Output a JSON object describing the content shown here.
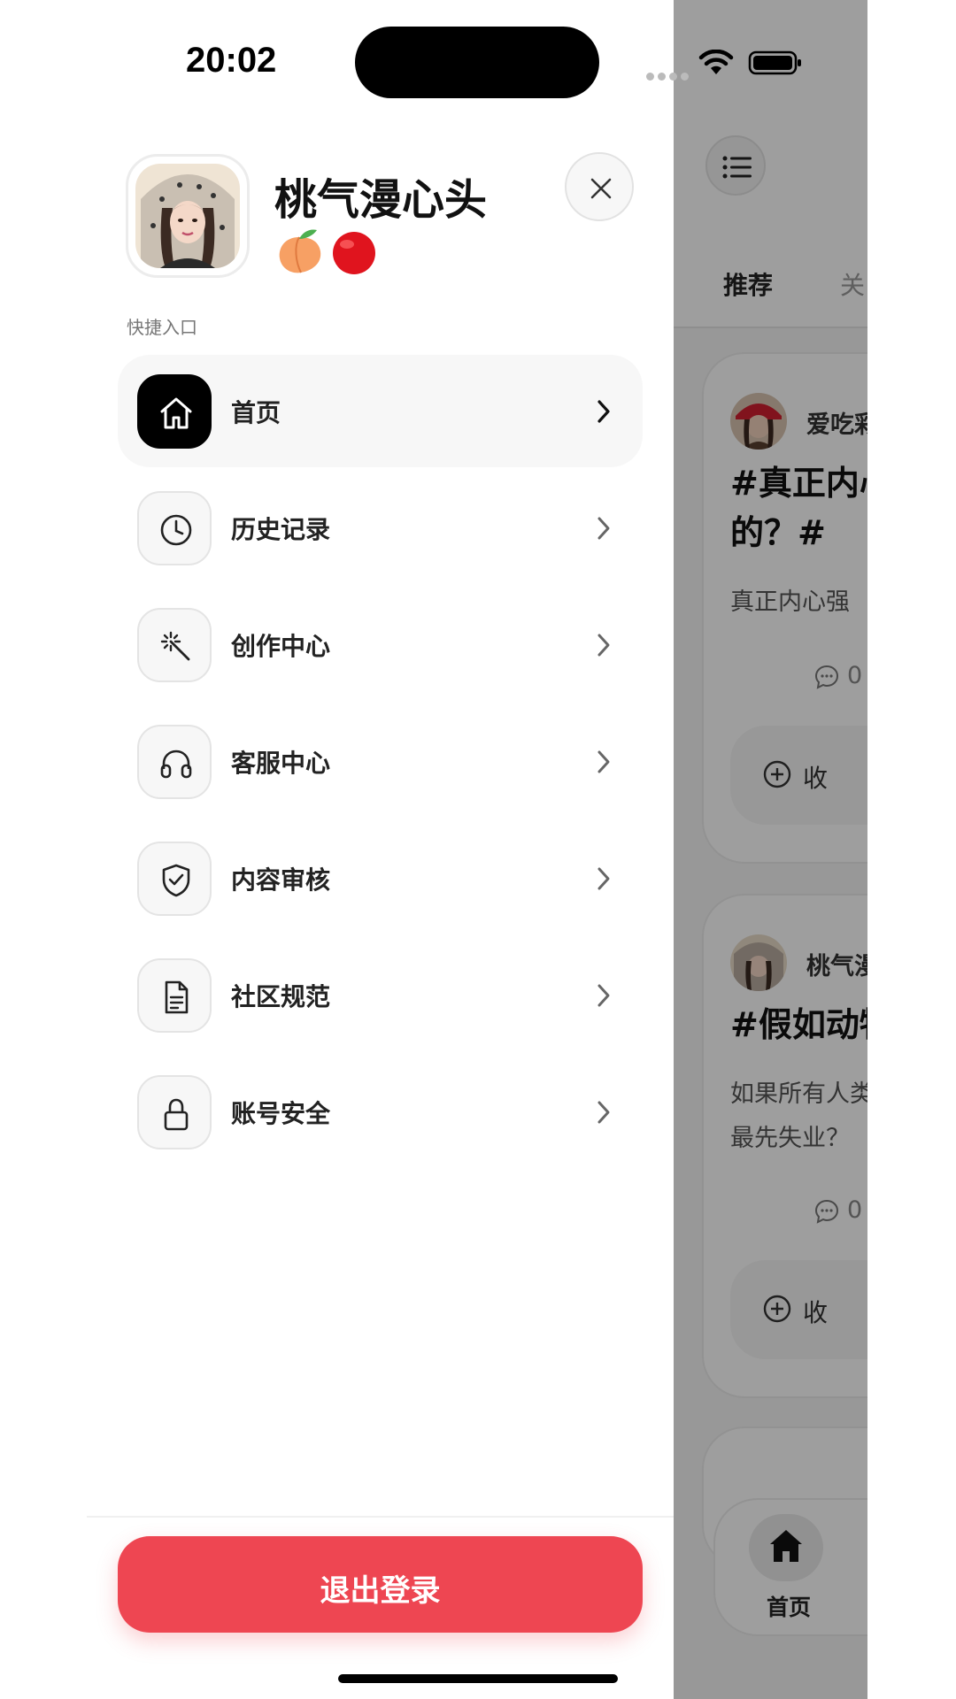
{
  "status_bar": {
    "time": "20:02"
  },
  "profile": {
    "name": "桃气漫心头",
    "emoji_icons": [
      "peach-emoji",
      "red-circle-emoji"
    ]
  },
  "drawer": {
    "section_label": "快捷入口",
    "menu": [
      {
        "label": "首页",
        "icon": "home-icon",
        "active": true
      },
      {
        "label": "历史记录",
        "icon": "clock-icon",
        "active": false
      },
      {
        "label": "创作中心",
        "icon": "magic-wand-icon",
        "active": false
      },
      {
        "label": "客服中心",
        "icon": "headphones-icon",
        "active": false
      },
      {
        "label": "内容审核",
        "icon": "shield-check-icon",
        "active": false
      },
      {
        "label": "社区规范",
        "icon": "document-icon",
        "active": false
      },
      {
        "label": "账号安全",
        "icon": "lock-icon",
        "active": false
      }
    ],
    "logout_label": "退出登录"
  },
  "background_app": {
    "tabs": [
      "推荐",
      "关"
    ],
    "posts": [
      {
        "author": "爱吃彩",
        "title": "#真正内心\n的？#",
        "body": "真正内心强",
        "comments": "0",
        "collect": "收"
      },
      {
        "author": "桃气漫",
        "title": "#假如动物",
        "body": "如果所有人类\n最先失业？",
        "comments": "0",
        "collect": "收"
      }
    ],
    "bottom_nav": {
      "label": "首页"
    }
  },
  "colors": {
    "logout_red": "#ee4652",
    "active_icon_bg": "#000000",
    "overlay": "rgba(0,0,0,0.38)"
  }
}
